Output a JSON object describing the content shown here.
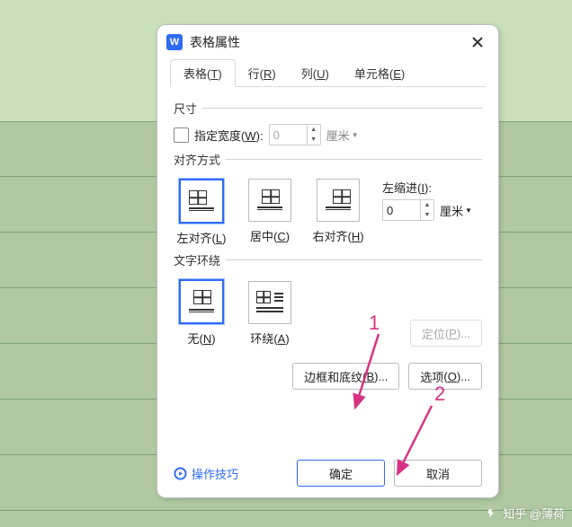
{
  "dialog": {
    "title": "表格属性",
    "tabs": [
      {
        "label": "表格",
        "key": "T",
        "active": true
      },
      {
        "label": "行",
        "key": "R",
        "active": false
      },
      {
        "label": "列",
        "key": "U",
        "active": false
      },
      {
        "label": "单元格",
        "key": "E",
        "active": false
      }
    ],
    "size": {
      "legend": "尺寸",
      "specify_width_label": "指定宽度",
      "specify_width_key": "W",
      "width_value": "0",
      "width_unit": "厘米"
    },
    "alignment": {
      "legend": "对齐方式",
      "options": [
        {
          "label": "左对齐",
          "key": "L",
          "selected": true
        },
        {
          "label": "居中",
          "key": "C",
          "selected": false
        },
        {
          "label": "右对齐",
          "key": "H",
          "selected": false
        }
      ],
      "indent_label": "左缩进",
      "indent_key": "I",
      "indent_value": "0",
      "indent_unit": "厘米"
    },
    "wrap": {
      "legend": "文字环绕",
      "options": [
        {
          "label": "无",
          "key": "N",
          "selected": true
        },
        {
          "label": "环绕",
          "key": "A",
          "selected": false
        }
      ],
      "position_btn": "定位",
      "position_key": "P"
    },
    "borders_btn_label": "边框和底纹",
    "borders_btn_key": "B",
    "options_btn_label": "选项",
    "options_btn_key": "O",
    "tips_label": "操作技巧",
    "ok_label": "确定",
    "cancel_label": "取消"
  },
  "annotations": {
    "a1": "1",
    "a2": "2"
  },
  "watermark": "知乎 @薄荷"
}
